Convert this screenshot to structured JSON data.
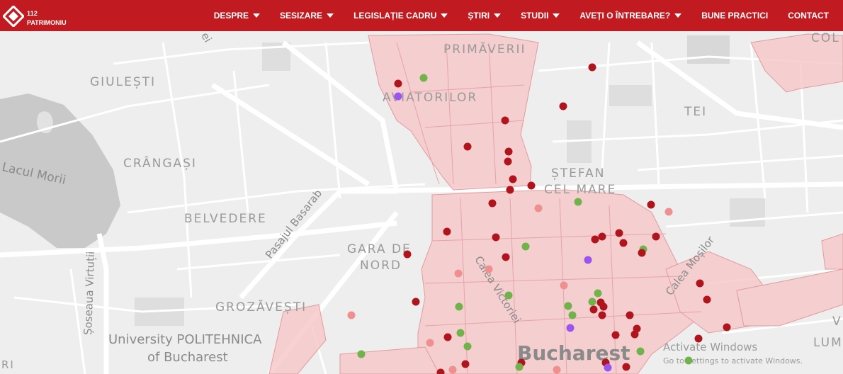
{
  "header": {
    "logo_number": "112",
    "logo_name": "PATRIMONIU",
    "menu": [
      {
        "label": "DESPRE",
        "dropdown": true
      },
      {
        "label": "SESIZARE",
        "dropdown": true
      },
      {
        "label": "LEGISLAȚIE CADRU",
        "dropdown": true
      },
      {
        "label": "ȘTIRI",
        "dropdown": true
      },
      {
        "label": "STUDII",
        "dropdown": true
      },
      {
        "label": "AVEȚI O ÎNTREBARE?",
        "dropdown": true
      },
      {
        "label": "BUNE PRACTICI",
        "dropdown": false
      },
      {
        "label": "CONTACT",
        "dropdown": false
      }
    ],
    "colors": {
      "nav_bg": "#c11b21",
      "nav_text": "#ffffff"
    }
  },
  "map": {
    "labels": {
      "primaverii": "PRIMĂVERII",
      "aviatorilor": "AVIATORILOR",
      "giulesti": "GIULEȘTI",
      "tei": "TEI",
      "col": "COL",
      "crangasi": "CRÂNGAȘI",
      "stefan": "ȘTEFAN",
      "cel_mare": "CEL MARE",
      "lacul_morii": "Lacul Morii",
      "belvedere": "BELVEDERE",
      "gara_de": "GARA DE",
      "nord": "NORD",
      "pasajul_basarab": "Pasajul Basarab",
      "calea_victoriei": "Calea Victoriei",
      "calea_mosilor": "Calea Moșilor",
      "soseaua_virtutii": "Șoseaua Virtuții",
      "grozavesti": "GROZĂVEȘTI",
      "v": "V",
      "lum": "LUM",
      "university_1": "University POLITEHNICA",
      "university_2": "of Bucharest",
      "bucharest": "Bucharest",
      "ri": "RI",
      "ei": "ei"
    },
    "watermark": {
      "title": "Activate Windows",
      "subtitle": "Go to Settings to activate Windows."
    },
    "marker_colors": {
      "dark_red": "#b0141c",
      "light_red": "#f08f8f",
      "green": "#6fb34a",
      "purple": "#9a55f0"
    },
    "zone_colors": {
      "fill": "#f7c9cb",
      "stroke": "#e28c91"
    }
  }
}
